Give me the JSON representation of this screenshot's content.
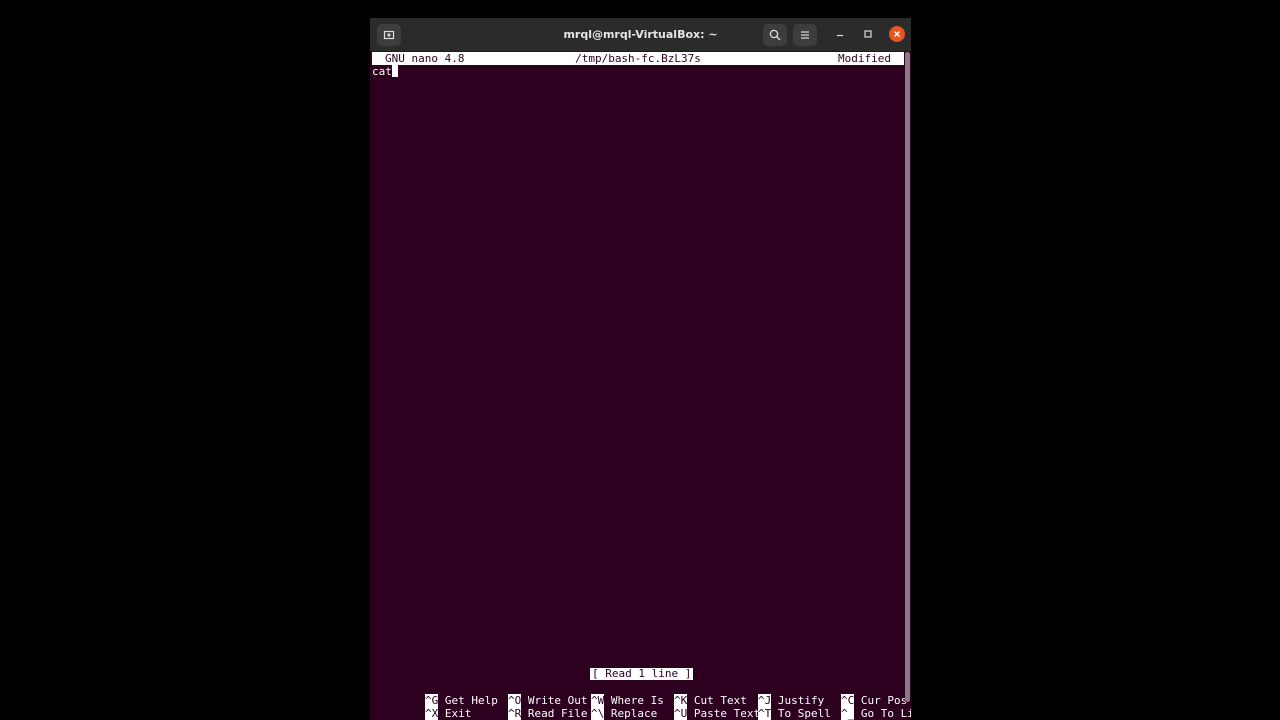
{
  "window": {
    "title": "mrql@mrql-VirtualBox: ~"
  },
  "nano": {
    "version": "GNU nano 4.8",
    "filename": "/tmp/bash-fc.BzL37s",
    "state": "Modified",
    "content_line": "cat",
    "status_message": "[ Read 1 line ]"
  },
  "shortcuts": [
    {
      "key": "^G",
      "label": "Get Help"
    },
    {
      "key": "^O",
      "label": "Write Out"
    },
    {
      "key": "^W",
      "label": "Where Is"
    },
    {
      "key": "^K",
      "label": "Cut Text"
    },
    {
      "key": "^J",
      "label": "Justify"
    },
    {
      "key": "^C",
      "label": "Cur Pos"
    },
    {
      "key": "^X",
      "label": "Exit"
    },
    {
      "key": "^R",
      "label": "Read File"
    },
    {
      "key": "^\\",
      "label": "Replace"
    },
    {
      "key": "^U",
      "label": "Paste Text"
    },
    {
      "key": "^T",
      "label": "To Spell"
    },
    {
      "key": "^_",
      "label": "Go To Line"
    }
  ],
  "colors": {
    "terminal_bg": "#2c001e",
    "titlebar_bg": "#2b2b2b",
    "close_button": "#e95420"
  }
}
